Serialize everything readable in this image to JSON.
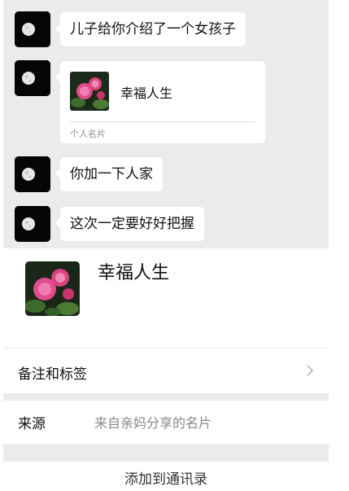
{
  "chat": {
    "messages": [
      {
        "type": "text",
        "text": "儿子给你介绍了一个女孩子"
      },
      {
        "type": "card",
        "name": "幸福人生",
        "card_type": "个人名片"
      },
      {
        "type": "text",
        "text": "你加一下人家"
      },
      {
        "type": "text",
        "text": "这次一定要好好把握"
      }
    ]
  },
  "profile": {
    "name": "幸福人生",
    "remark_label": "备注和标签",
    "source_label": "来源",
    "source_value": "来自亲妈分享的名片",
    "add_button": "添加到通讯录"
  },
  "icons": {
    "avatar": "moon-icon",
    "photo": "rose-flower-icon",
    "chevron": "chevron-right-icon"
  },
  "colors": {
    "chat_background": "#ebebeb",
    "bubble": "#ffffff",
    "secondary_text": "#888888"
  }
}
